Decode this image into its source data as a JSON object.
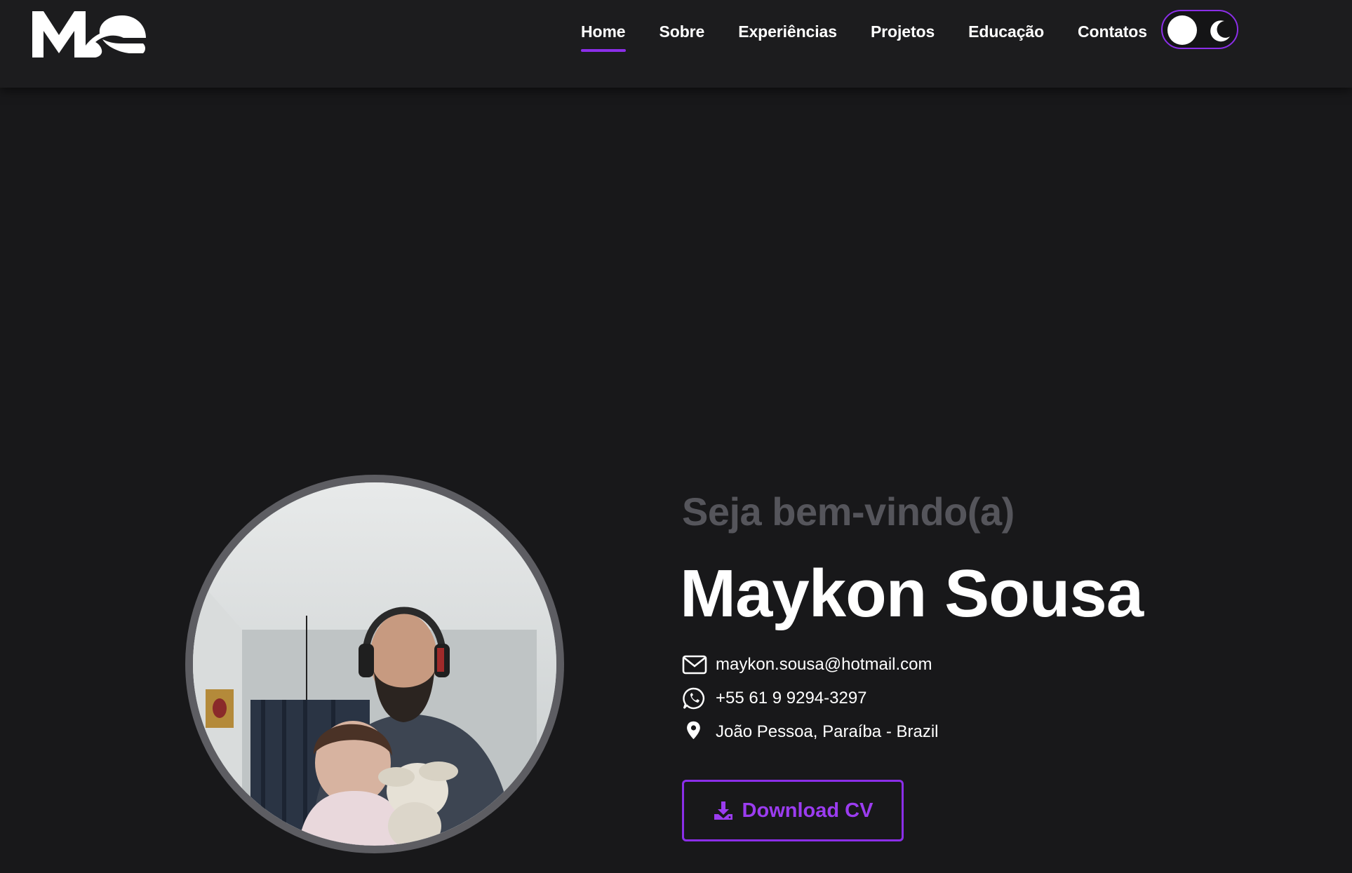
{
  "brand": {
    "logo_text": "MS"
  },
  "nav": {
    "items": [
      {
        "label": "Home",
        "active": true
      },
      {
        "label": "Sobre",
        "active": false
      },
      {
        "label": "Experiências",
        "active": false
      },
      {
        "label": "Projetos",
        "active": false
      },
      {
        "label": "Educação",
        "active": false
      },
      {
        "label": "Contatos",
        "active": false
      }
    ],
    "theme_toggle_icon": "moon-icon"
  },
  "hero": {
    "greeting": "Seja bem-vindo(a)",
    "name": "Maykon Sousa",
    "contacts": {
      "email": "maykon.sousa@hotmail.com",
      "phone": "+55 61 9 9294-3297",
      "location": "João Pessoa, Paraíba - Brazil"
    },
    "download_label": "Download CV"
  },
  "colors": {
    "background": "#18181a",
    "navbar": "#1c1c1e",
    "accent": "#8b2ee8",
    "accent_text": "#9b3cf0",
    "greeting": "#55555b"
  }
}
